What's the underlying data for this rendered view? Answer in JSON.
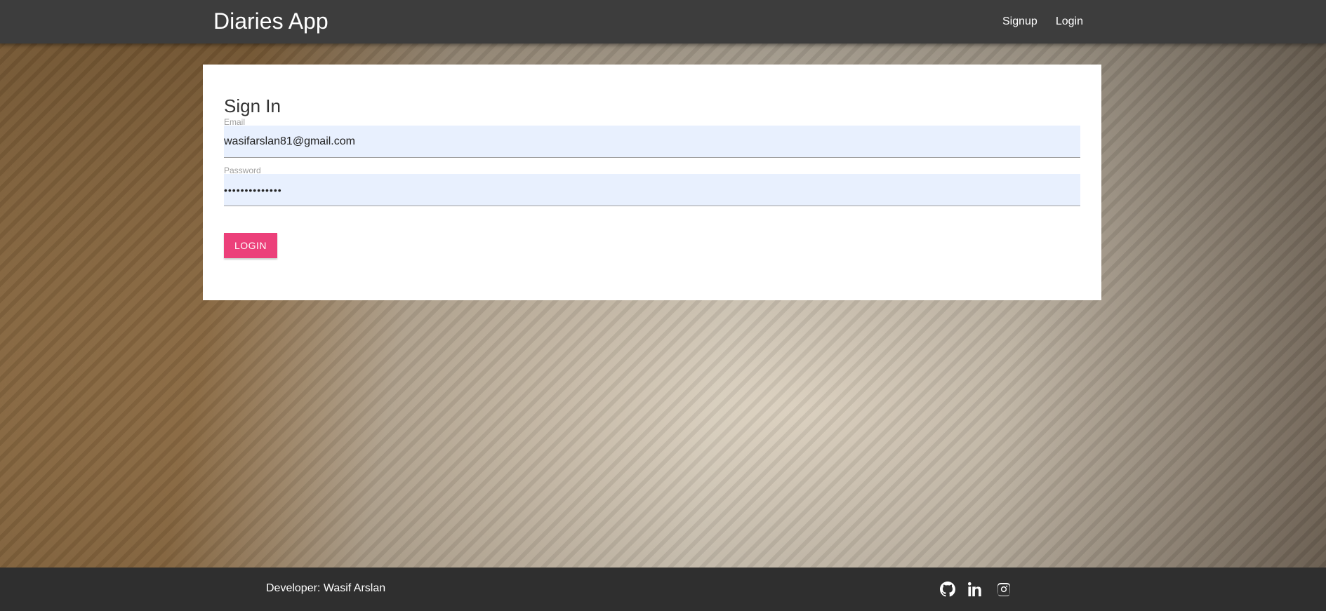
{
  "navbar": {
    "brand": "Diaries App",
    "links": [
      "Signup",
      "Login"
    ]
  },
  "signin": {
    "title": "Sign In",
    "email_label": "Email",
    "email_value": "wasifarslan81@gmail.com",
    "password_label": "Password",
    "password_value": "••••••••••••••",
    "login_button": "LOGIN"
  },
  "footer": {
    "developer": "Developer: Wasif Arslan",
    "social_icons": [
      "github-icon",
      "linkedin-icon",
      "instagram-icon"
    ]
  },
  "colors": {
    "navbar": "#3d3d3d",
    "footer": "#2f2f2f",
    "accent": "#ec407a",
    "input_bg": "#e8f0fe"
  }
}
